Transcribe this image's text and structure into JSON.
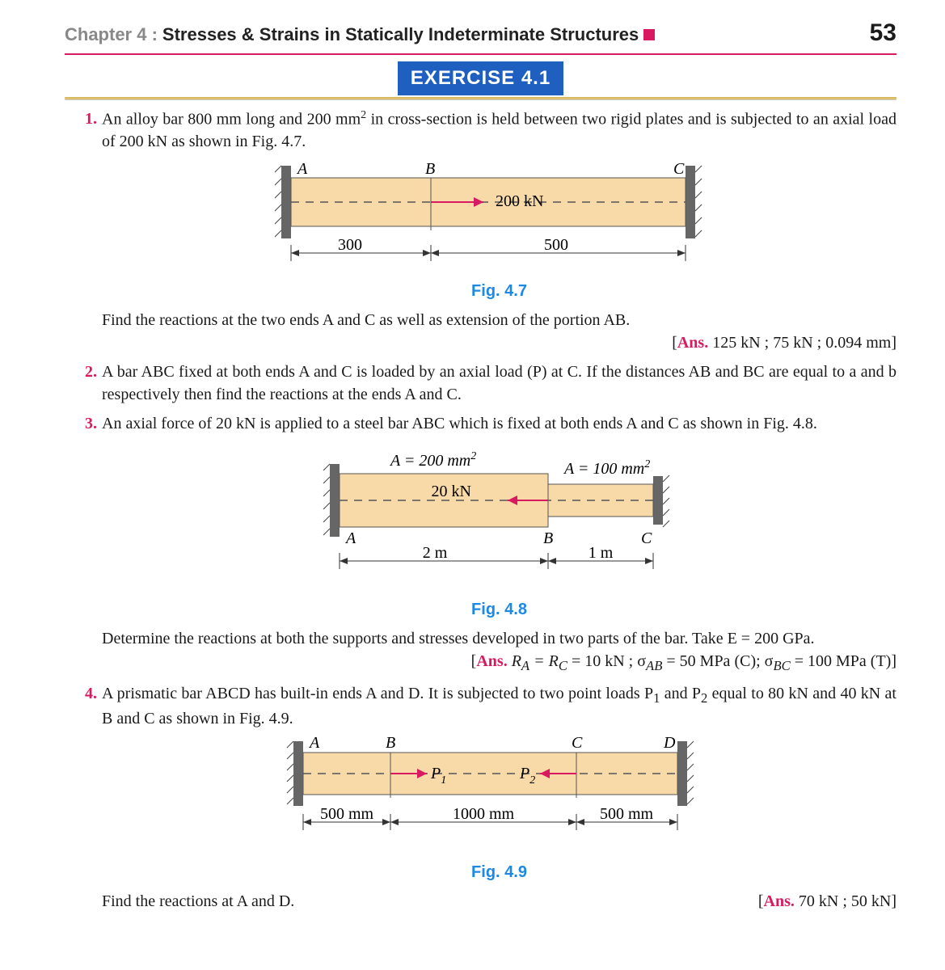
{
  "header": {
    "chapter": "Chapter 4 :",
    "title": "Stresses & Strains in Statically Indeterminate Structures",
    "page": "53"
  },
  "exercise_label": "EXERCISE  4.1",
  "q1": {
    "text_a": "An alloy bar 800 mm long and 200 mm",
    "text_b": " in cross-section is held between two rigid plates and is subjected to an axial load of 200 kN as shown in Fig. 4.7.",
    "fig": {
      "A": "A",
      "B": "B",
      "C": "C",
      "load": "200 kN",
      "d1": "300",
      "d2": "500",
      "cap": "Fig. 4.7"
    },
    "text_c": "Find the reactions at the two ends A and C as well as extension of the portion AB.",
    "ans": "125 kN ; 75 kN ; 0.094 mm]"
  },
  "q2": {
    "text": "A bar ABC fixed at both ends A and C is loaded by an axial load (P) at C. If the distances AB and BC are equal to a and b respectively then find the reactions at the ends A and C."
  },
  "q3": {
    "text_a": "An axial force of 20 kN is applied to a steel bar ABC which is fixed at both ends A and C as shown in Fig. 4.8.",
    "fig": {
      "a1": "A = 200 mm",
      "a2": "A = 100 mm",
      "load": "20 kN",
      "A": "A",
      "B": "B",
      "C": "C",
      "d1": "2 m",
      "d2": "1 m",
      "cap": "Fig. 4.8"
    },
    "text_b": "Determine the reactions at both the supports and stresses developed in two parts of the bar. Take E = 200 GPa.",
    "ans_a": "R",
    "ans_b": " = R",
    "ans_c": " = 10 kN ; σ",
    "ans_d": " = 50 MPa (C); σ",
    "ans_e": " = 100 MPa (T)]"
  },
  "q4": {
    "text_a": "A prismatic bar ABCD has built-in ends A and D. It is subjected to two point loads P",
    "text_b": " and P",
    "text_c": " equal to 80 kN and 40 kN at B and C as shown in Fig. 4.9.",
    "fig": {
      "A": "A",
      "B": "B",
      "C": "C",
      "D": "D",
      "P1": "P",
      "P2": "P",
      "d1": "500 mm",
      "d2": "1000 mm",
      "d3": "500 mm",
      "cap": "Fig. 4.9"
    },
    "text_d": "Find the reactions at A and D.",
    "ans": "70 kN ; 50 kN]"
  }
}
